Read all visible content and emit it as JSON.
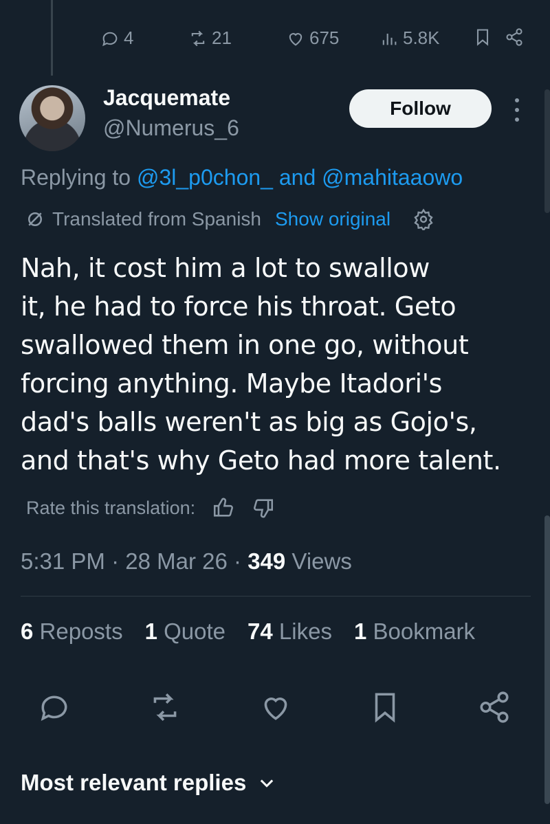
{
  "previous_tweet": {
    "actions": {
      "replies": "4",
      "reposts": "21",
      "likes": "675",
      "views": "5.8K"
    }
  },
  "tweet": {
    "display_name": "Jacquemate",
    "handle": "@Numerus_6",
    "follow_label": "Follow",
    "replying_prefix": "Replying to",
    "replying_user1": "@3l_p0chon_",
    "replying_and": "and",
    "replying_user2": "@mahitaaowo",
    "translated_label": "Translated from Spanish",
    "show_original": "Show original",
    "text": "Nah, it cost him a lot to swallow\nit, he had to force his throat. Geto\nswallowed them in one go, without\nforcing anything. Maybe Itadori's\ndad's balls weren't as big as Gojo's,\nand that's why Geto had more talent.",
    "rate_label": "Rate this translation:",
    "time": "5:31 PM",
    "date": "28 Mar 26",
    "views_count": "349",
    "views_label": "Views",
    "stats": {
      "reposts_count": "6",
      "reposts_label": "Reposts",
      "quotes_count": "1",
      "quotes_label": "Quote",
      "likes_count": "74",
      "likes_label": "Likes",
      "bookmarks_count": "1",
      "bookmarks_label": "Bookmark"
    }
  },
  "replies_section": {
    "title": "Most relevant replies"
  },
  "icons": [
    "reply-icon",
    "repost-icon",
    "like-icon",
    "views-icon",
    "bookmark-icon",
    "share-icon",
    "more-icon",
    "translate-icon",
    "settings-icon",
    "thumbs-up-icon",
    "thumbs-down-icon",
    "chevron-down-icon"
  ],
  "colors": {
    "background": "#15202b",
    "text": "#f7f9f9",
    "muted": "#8b98a5",
    "link": "#1d9bf0",
    "follow_bg": "#eff3f4"
  }
}
